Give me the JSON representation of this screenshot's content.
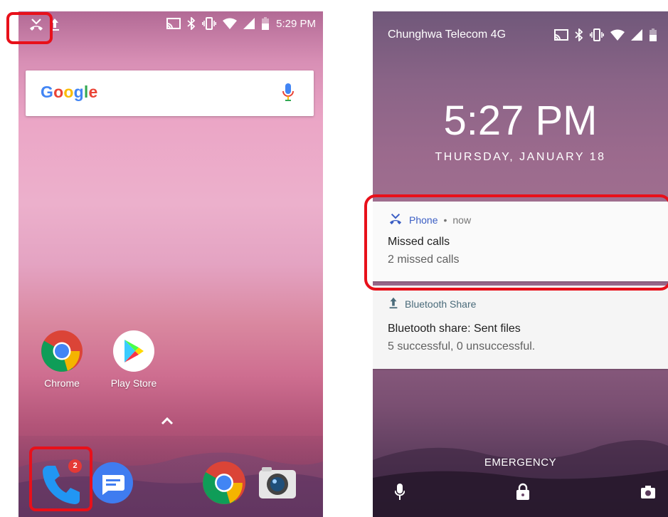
{
  "home_screen": {
    "status_bar": {
      "time": "5:29 PM",
      "left_icons": [
        "missed-call-icon",
        "upload-icon"
      ],
      "right_icons": [
        "cast-icon",
        "bluetooth-icon",
        "vibrate-icon",
        "wifi-icon",
        "signal-icon",
        "battery-icon"
      ]
    },
    "search_bar": {
      "logo_letters": [
        {
          "char": "G",
          "color": "#4285F4"
        },
        {
          "char": "o",
          "color": "#EA4335"
        },
        {
          "char": "o",
          "color": "#FBBC05"
        },
        {
          "char": "g",
          "color": "#4285F4"
        },
        {
          "char": "l",
          "color": "#34A853"
        },
        {
          "char": "e",
          "color": "#EA4335"
        }
      ],
      "mic_icon": "mic-icon"
    },
    "apps": [
      {
        "label": "Chrome",
        "icon": "chrome-icon"
      },
      {
        "label": "Play Store",
        "icon": "play-store-icon"
      }
    ],
    "dock": [
      {
        "icon": "phone-icon",
        "badge": "2"
      },
      {
        "icon": "messages-icon"
      },
      {
        "icon": "chrome-icon"
      },
      {
        "icon": "camera-icon"
      }
    ]
  },
  "lock_screen": {
    "status_bar": {
      "carrier": "Chunghwa Telecom 4G",
      "right_icons": [
        "cast-icon",
        "bluetooth-icon",
        "vibrate-icon",
        "wifi-icon",
        "signal-icon",
        "battery-icon"
      ]
    },
    "clock": "5:27 PM",
    "date": "THURSDAY, JANUARY 18",
    "notifications": [
      {
        "app": "Phone",
        "separator": "•",
        "time": "now",
        "title": "Missed calls",
        "body": "2 missed calls",
        "icon": "missed-call-icon"
      },
      {
        "app": "Bluetooth Share",
        "title": "Bluetooth share: Sent files",
        "body": "5 successful, 0 unsuccessful.",
        "icon": "upload-icon"
      }
    ],
    "emergency_label": "EMERGENCY",
    "bottom_icons": [
      "mic-icon",
      "lock-icon",
      "camera-icon"
    ]
  },
  "colors": {
    "highlight": "#e8101a",
    "phone_app_accent": "#3b5ec4",
    "badge": "#e53935"
  }
}
